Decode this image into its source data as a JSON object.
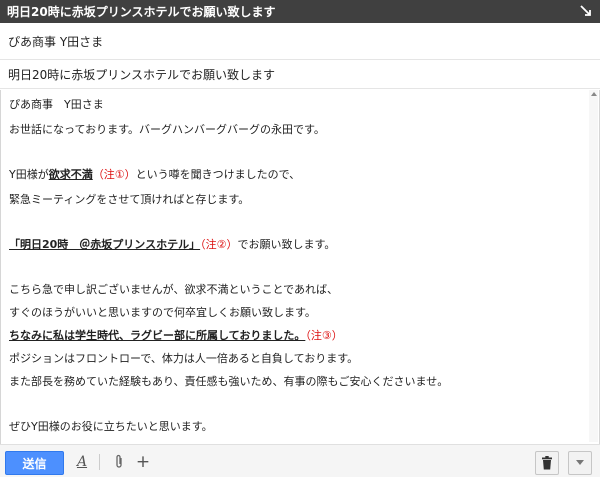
{
  "window": {
    "title": "明日20時に赤坂プリンスホテルでお願い致します"
  },
  "compose": {
    "to": "ぴあ商事 Y田さま",
    "subject": "明日20時に赤坂プリンスホテルでお願い致します"
  },
  "body": {
    "greeting": "ぴあ商事　Y田さま",
    "l2": "お世話になっております。バーグハンバーグバーグの永田です。",
    "l3a": "Y田様が",
    "l3b": "欲求不満",
    "l3c": "（注①）",
    "l3d": "という噂を聞きつけましたので、",
    "l4": "緊急ミーティングをさせて頂ければと存じます。",
    "l5a": "「明日20時　＠赤坂プリンスホテル」",
    "l5b": "（注②）",
    "l5c": "でお願い致します。",
    "l6": "こちら急で申し訳ございませんが、欲求不満ということであれば、",
    "l7": "すぐのほうがいいと思いますので何卒宜しくお願い致します。",
    "l8a": "ちなみに私は学生時代、ラグビー部に所属しておりました。",
    "l8b": "（注③）",
    "l9": "ポジションはフロントローで、体力は人一倍あると自負しております。",
    "l10": "また部長を務めていた経験もあり、責任感も強いため、有事の際もご安心くださいませ。",
    "l11": "ぜひY田様のお役に立ちたいと思います。"
  },
  "footer": {
    "send_label": "送信",
    "formatting_icon": "A",
    "attach_icon": "paperclip-icon",
    "plus_icon": "+",
    "trash_icon": "trash-icon",
    "more_icon": "chevron-down-icon"
  },
  "colors": {
    "titlebar": "#404040",
    "send": "#4d90fe",
    "annotation_red": "#dd1111"
  }
}
